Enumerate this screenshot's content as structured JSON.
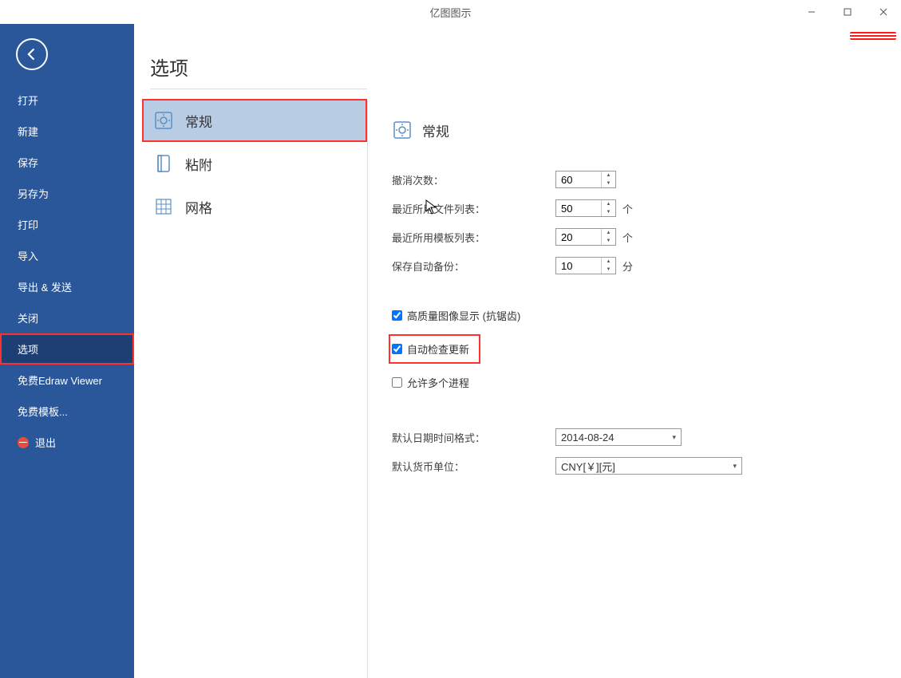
{
  "app_title": "亿图图示",
  "sidebar": {
    "items": [
      {
        "label": "打开"
      },
      {
        "label": "新建"
      },
      {
        "label": "保存"
      },
      {
        "label": "另存为"
      },
      {
        "label": "打印"
      },
      {
        "label": "导入"
      },
      {
        "label": "导出 & 发送"
      },
      {
        "label": "关闭"
      },
      {
        "label": "选项"
      },
      {
        "label": "免费Edraw Viewer"
      },
      {
        "label": "免费模板..."
      },
      {
        "label": "退出"
      }
    ]
  },
  "page_title": "选项",
  "sub_nav": {
    "items": [
      {
        "label": "常规"
      },
      {
        "label": "粘附"
      },
      {
        "label": "网格"
      }
    ]
  },
  "content": {
    "header": "常规",
    "undo_label": "撤消次数：",
    "undo_value": "60",
    "recent_files_label": "最近所用文件列表：",
    "recent_files_value": "50",
    "recent_files_unit": "个",
    "recent_templates_label": "最近所用模板列表：",
    "recent_templates_value": "20",
    "recent_templates_unit": "个",
    "autosave_label": "保存自动备份：",
    "autosave_value": "10",
    "autosave_unit": "分",
    "high_quality_label": "高质量图像显示 (抗锯齿)",
    "auto_update_label": "自动检查更新",
    "multi_process_label": "允许多个进程",
    "date_format_label": "默认日期时间格式：",
    "date_format_value": "2014-08-24",
    "currency_label": "默认货币单位：",
    "currency_value": "CNY[￥][元]"
  }
}
